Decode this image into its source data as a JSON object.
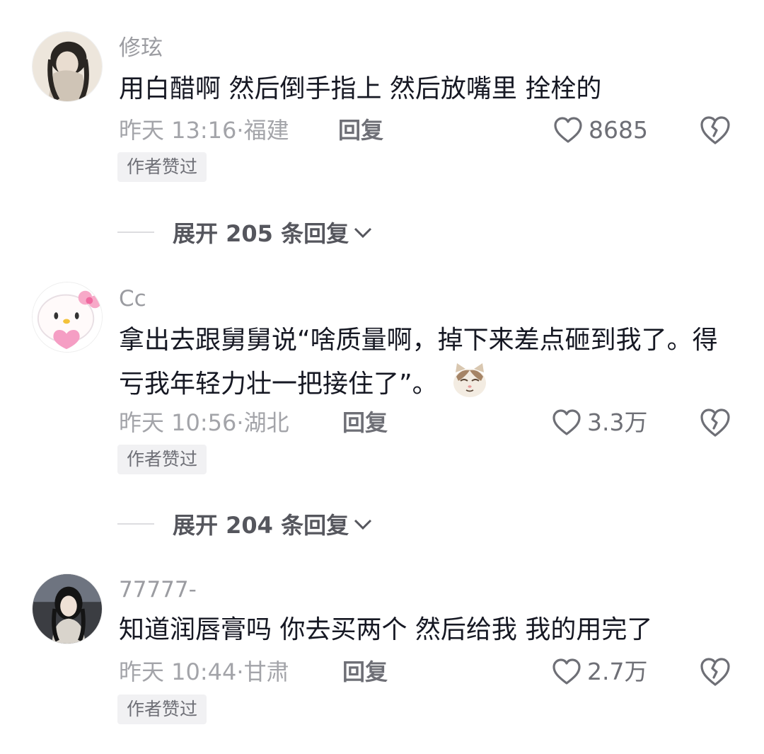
{
  "comments": [
    {
      "username": "修玹",
      "content": "用白醋啊 然后倒手指上 然后放嘴里   拴栓的",
      "time": "昨天 13:16",
      "location": "福建",
      "reply_label": "回复",
      "likes": "8685",
      "badge": "作者赞过",
      "expand_label": "展开 205 条回复"
    },
    {
      "username": "Cc",
      "content": "拿出去跟舅舅说“啥质量啊，掉下来差点砸到我了。得亏我年轻力壮一把接住了”。",
      "emoji": "cat-face-emoji",
      "time": "昨天 10:56",
      "location": "湖北",
      "reply_label": "回复",
      "likes": "3.3万",
      "badge": "作者赞过",
      "expand_label": "展开 204 条回复"
    },
    {
      "username": "77777-",
      "content": "知道润唇膏吗 你去买两个 然后给我 我的用完了",
      "time": "昨天 10:44",
      "location": "甘肃",
      "reply_label": "回复",
      "likes": "2.7万",
      "badge": "作者赞过"
    }
  ],
  "separator": "·",
  "icons": {
    "like": "heart-outline-icon",
    "dislike": "broken-heart-icon",
    "expand": "chevron-down-icon"
  }
}
